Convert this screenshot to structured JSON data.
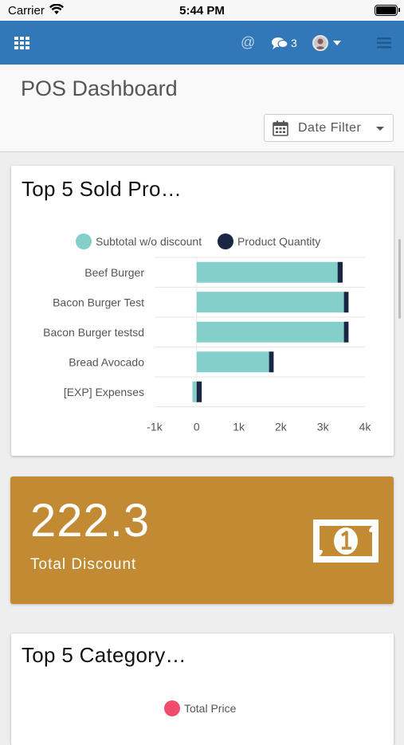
{
  "status_bar": {
    "carrier": "Carrier",
    "time": "5:44 PM"
  },
  "navbar": {
    "chat_count": "3"
  },
  "header": {
    "title": "POS Dashboard",
    "date_filter_label": "Date Filter"
  },
  "cards": {
    "top_products": {
      "title": "Top 5 Sold Pro…",
      "legend": [
        {
          "label": "Subtotal w/o discount",
          "color": "#85cfcb"
        },
        {
          "label": "Product Quantity",
          "color": "#1a2744"
        }
      ]
    },
    "total_discount": {
      "value": "222.3",
      "label": "Total Discount",
      "color": "#c28a33"
    },
    "top_categories": {
      "title": "Top 5 Category…",
      "legend": [
        {
          "label": "Total Price",
          "color": "#ee4c6a"
        }
      ]
    }
  },
  "chart_data": {
    "type": "bar",
    "orientation": "horizontal",
    "stacked": true,
    "categories": [
      "Beef Burger",
      "Bacon Burger Test",
      "Bacon Burger testsd",
      "Bread Avocado",
      "[EXP] Expenses"
    ],
    "series": [
      {
        "name": "Subtotal w/o discount",
        "values": [
          3350,
          3500,
          3500,
          1720,
          -100
        ],
        "color": "#85cfcb"
      },
      {
        "name": "Product Quantity",
        "values": [
          120,
          110,
          110,
          110,
          120
        ],
        "color": "#1a2744"
      }
    ],
    "xlim": [
      -1000,
      4000
    ],
    "xticks": [
      -1000,
      0,
      1000,
      2000,
      3000,
      4000
    ],
    "xtick_labels": [
      "-1k",
      "0",
      "1k",
      "2k",
      "3k",
      "4k"
    ],
    "grid": true,
    "legend_position": "top"
  }
}
